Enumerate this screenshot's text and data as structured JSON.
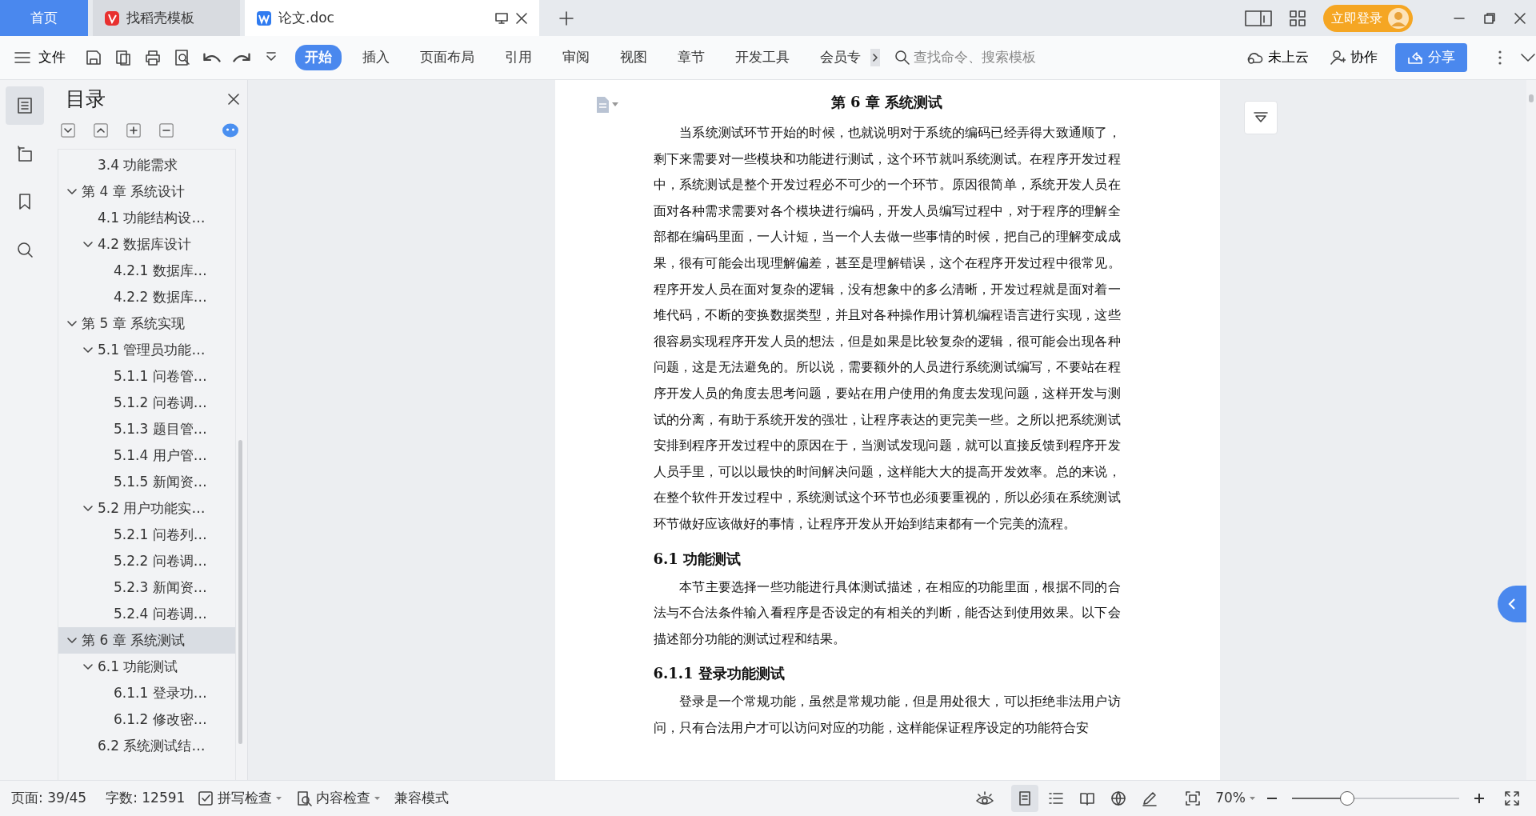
{
  "tabs": [
    {
      "label": "首页",
      "kind": "home",
      "selected": false
    },
    {
      "label": "找稻壳模板",
      "kind": "template",
      "selected": false
    },
    {
      "label": "论文.doc",
      "kind": "doc",
      "selected": true
    }
  ],
  "login_button": "立即登录",
  "file_menu": "文件",
  "ribbon_tabs": [
    {
      "label": "开始",
      "selected": true
    },
    {
      "label": "插入",
      "selected": false
    },
    {
      "label": "页面布局",
      "selected": false
    },
    {
      "label": "引用",
      "selected": false
    },
    {
      "label": "审阅",
      "selected": false
    },
    {
      "label": "视图",
      "selected": false
    },
    {
      "label": "章节",
      "selected": false
    },
    {
      "label": "开发工具",
      "selected": false
    },
    {
      "label": "会员专",
      "selected": false
    }
  ],
  "command_search": {
    "placeholder": "查找命令、搜索模板"
  },
  "cloud_status": "未上云",
  "collaborate": "协作",
  "share_button": "分享",
  "side_panels": [
    {
      "kind": "outline",
      "selected": true
    },
    {
      "kind": "navigation",
      "selected": false
    },
    {
      "kind": "bookmark",
      "selected": false
    },
    {
      "kind": "search",
      "selected": false
    }
  ],
  "outline": {
    "title": "目录",
    "items": [
      {
        "children": [
          {
            "label": "3.4  功能需求",
            "selected": false
          }
        ]
      },
      {
        "label": "第 4 章  系统设计",
        "selected": false,
        "expanded": true,
        "children": [
          {
            "label": "4.1  功能结构设…",
            "selected": false
          },
          {
            "label": "4.2  数据库设计",
            "selected": false,
            "expanded": true,
            "children": [
              {
                "label": "4.2.1  数据库…",
                "selected": false
              },
              {
                "label": "4.2.2  数据库…",
                "selected": false
              }
            ]
          }
        ]
      },
      {
        "label": "第 5 章  系统实现",
        "selected": false,
        "expanded": true,
        "children": [
          {
            "label": "5.1  管理员功能…",
            "selected": false,
            "expanded": true,
            "children": [
              {
                "label": "5.1.1  问卷管…",
                "selected": false
              },
              {
                "label": "5.1.2  问卷调…",
                "selected": false
              },
              {
                "label": "5.1.3  题目管…",
                "selected": false
              },
              {
                "label": "5.1.4  用户管…",
                "selected": false
              },
              {
                "label": "5.1.5  新闻资…",
                "selected": false
              }
            ]
          },
          {
            "label": "5.2  用户功能实…",
            "selected": false,
            "expanded": true,
            "children": [
              {
                "label": "5.2.1  问卷列…",
                "selected": false
              },
              {
                "label": "5.2.2  问卷调…",
                "selected": false
              },
              {
                "label": "5.2.3  新闻资…",
                "selected": false
              },
              {
                "label": "5.2.4  问卷调…",
                "selected": false
              }
            ]
          }
        ]
      },
      {
        "label": "第 6 章  系统测试",
        "selected": true,
        "expanded": true,
        "children": [
          {
            "label": "6.1  功能测试",
            "selected": false,
            "expanded": true,
            "children": [
              {
                "label": "6.1.1  登录功…",
                "selected": false
              },
              {
                "label": "6.1.2  修改密…",
                "selected": false
              }
            ]
          },
          {
            "label": "6.2  系统测试结…",
            "selected": false
          }
        ]
      }
    ]
  },
  "document": {
    "blocks": [
      {
        "kind": "title",
        "text": "第 6 章  系统测试"
      },
      {
        "kind": "paragraph",
        "text": "当系统测试环节开始的时候，也就说明对于系统的编码已经弄得大致通顺了，剩下来需要对一些模块和功能进行测试，这个环节就叫系统测试。在程序开发过程中，系统测试是整个开发过程必不可少的一个环节。原因很简单，系统开发人员在面对各种需求需要对各个模块进行编码，开发人员编写过程中，对于程序的理解全部都在编码里面，一人计短，当一个人去做一些事情的时候，把自己的理解变成成果，很有可能会出现理解偏差，甚至是理解错误，这个在程序开发过程中很常见。程序开发人员在面对复杂的逻辑，没有想象中的多么清晰，开发过程就是面对着一堆代码，不断的变换数据类型，并且对各种操作用计算机编程语言进行实现，这些很容易实现程序开发人员的想法，但是如果是比较复杂的逻辑，很可能会出现各种问题，这是无法避免的。所以说，需要额外的人员进行系统测试编写，不要站在程序开发人员的角度去思考问题，要站在用户使用的角度去发现问题，这样开发与测试的分离，有助于系统开发的强壮，让程序表达的更完美一些。之所以把系统测试安排到程序开发过程中的原因在于，当测试发现问题，就可以直接反馈到程序开发人员手里，可以以最快的时间解决问题，这样能大大的提高开发效率。总的来说，在整个软件开发过程中，系统测试这个环节也必须要重视的，所以必须在系统测试环节做好应该做好的事情，让程序开发从开始到结束都有一个完美的流程。"
      },
      {
        "kind": "heading",
        "text": "6.1  功能测试"
      },
      {
        "kind": "paragraph",
        "text": "本节主要选择一些功能进行具体测试描述，在相应的功能里面，根据不同的合法与不合法条件输入看程序是否设定的有相关的判断，能否达到使用效果。以下会描述部分功能的测试过程和结果。"
      },
      {
        "kind": "heading",
        "text": "6.1.1  登录功能测试"
      },
      {
        "kind": "paragraph",
        "text": "登录是一个常规功能，虽然是常规功能，但是用处很大，可以拒绝非法用户访问，只有合法用户才可以访问对应的功能，这样能保证程序设定的功能符合安"
      }
    ]
  },
  "status_bar": {
    "page": "页面: 39/45",
    "word_count": "字数: 12591",
    "spell_check": "拼写检查",
    "content_check": "内容检查",
    "mode": "兼容模式",
    "view_modes": [
      {
        "kind": "page",
        "selected": true
      },
      {
        "kind": "outline",
        "selected": false
      },
      {
        "kind": "reading",
        "selected": false
      },
      {
        "kind": "web",
        "selected": false
      }
    ],
    "zoom": "70%",
    "zoom_slider": {
      "level": 0.33
    }
  }
}
